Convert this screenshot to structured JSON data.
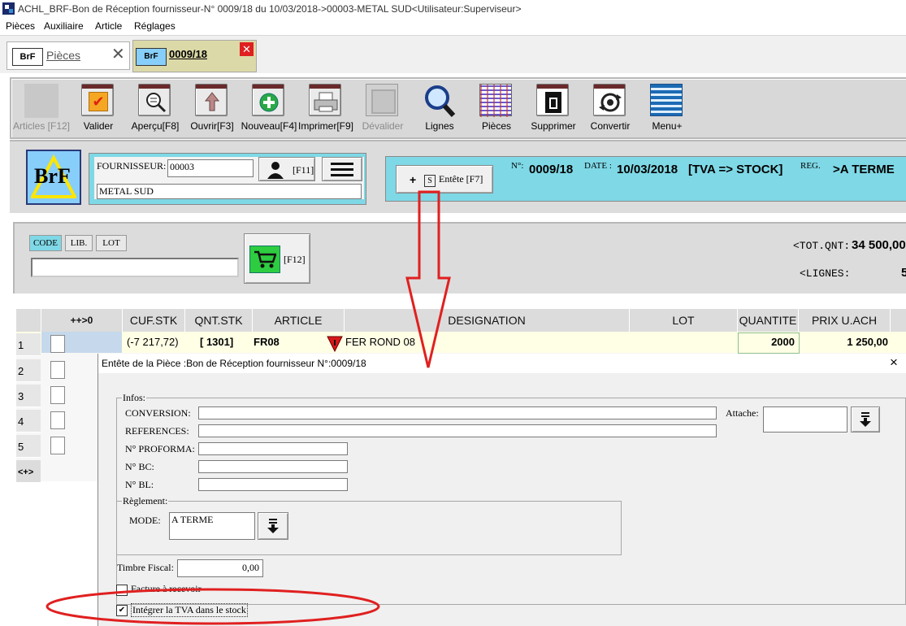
{
  "window": {
    "title": "ACHL_BRF-Bon de Réception fournisseur-N° 0009/18 du 10/03/2018->00003-METAL SUD<Utilisateur:Superviseur>"
  },
  "menu": [
    "Pièces",
    "Auxiliaire",
    "Article",
    "Réglages"
  ],
  "tabs": [
    {
      "icon_text": "BrF",
      "label": "Pièces"
    },
    {
      "icon_text": "BrF",
      "label": "0009/18"
    }
  ],
  "toolbar": [
    {
      "label": "Articles [F12]",
      "disabled": true
    },
    {
      "label": "Valider"
    },
    {
      "label": "Aperçu[F8]"
    },
    {
      "label": "Ouvrir[F3]"
    },
    {
      "label": "Nouveau[F4]"
    },
    {
      "label": "Imprimer[F9]"
    },
    {
      "label": "Dévalider",
      "disabled": true
    },
    {
      "label": "Lignes"
    },
    {
      "label": "Pièces"
    },
    {
      "label": "Supprimer"
    },
    {
      "label": "Convertir"
    },
    {
      "label": "Menu+"
    }
  ],
  "header": {
    "logo_text": "BrF",
    "fournisseur_label": "FOURNISSEUR:",
    "fournisseur_code": "00003",
    "fournisseur_name": "METAL SUD",
    "f11_label": "[F11]",
    "entete_plus": "+",
    "entete_s": "S",
    "entete_label": "Entête [F7]",
    "info_n_label": "N°:",
    "info_n_value": "0009/18",
    "info_date_label": "DATE :",
    "info_date_value": "10/03/2018",
    "info_tva_value": "[TVA => STOCK]",
    "info_reg_label": "REG.",
    "info_reg_value": ">A TERME"
  },
  "search": {
    "mode_buttons": [
      "CODE",
      "LIB.",
      "LOT"
    ],
    "f12_label": "[F12]",
    "tot_qnt_label": "<TOT.QNT:",
    "tot_qnt_value": "34 500,00",
    "lignes_label": "<LIGNES:",
    "lignes_value": "5"
  },
  "grid": {
    "columns": [
      "++>0",
      "CUF.STK",
      "QNT.STK",
      "ARTICLE",
      "DESIGNATION",
      "LOT",
      "QUANTITE",
      "PRIX U.ACH"
    ],
    "row_numbers": [
      "1",
      "2",
      "3",
      "4",
      "5"
    ],
    "footer_marker": "<+>",
    "rows": [
      {
        "cuf_stk": "(-7 217,72)",
        "qnt_stk": "[ 1301]",
        "article": "FR08",
        "designation": "FER ROND 08",
        "lot": "",
        "quantite": "2000",
        "prix": "1 250,00"
      }
    ]
  },
  "dialog": {
    "title": "Entête de la Pièce :Bon de Réception fournisseur N°:0009/18",
    "close": "×",
    "infos_legend": "Infos:",
    "conversion_label": "CONVERSION:",
    "references_label": "REFERENCES:",
    "proforma_label": "N° PROFORMA:",
    "bc_label": "N° BC:",
    "bl_label": "N° BL:",
    "attache_label": "Attache:",
    "reglement_legend": "Règlement:",
    "mode_label": "MODE:",
    "mode_value": "A TERME",
    "timbre_label": "Timbre Fiscal:",
    "timbre_value": "0,00",
    "facture_label": "Facture à recevoir",
    "facture_checked": false,
    "integrer_label": "Intégrer la TVA dans le stock",
    "integrer_checked": true
  },
  "annotation": {
    "color": "#e02020"
  }
}
